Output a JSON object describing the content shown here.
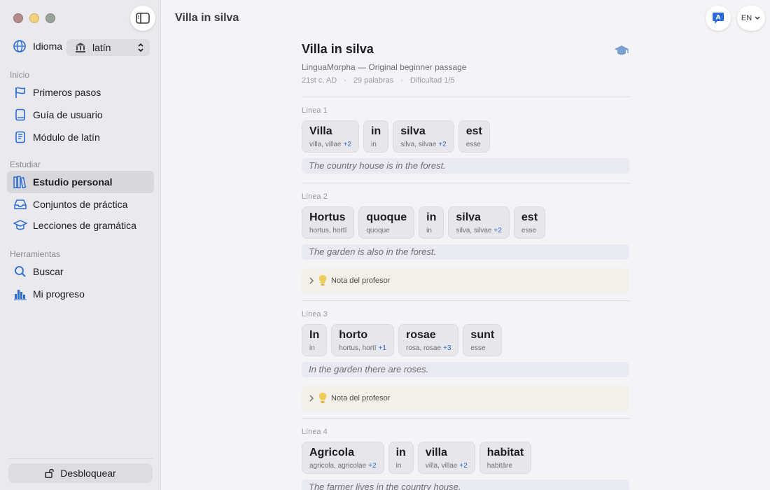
{
  "window": {
    "title": "Villa in silva"
  },
  "sidebar": {
    "language_label": "Idioma",
    "language_value": "latín",
    "sections": [
      {
        "title": "Inicio",
        "items": [
          {
            "label": "Primeros pasos",
            "icon": "flag-icon"
          },
          {
            "label": "Guía de usuario",
            "icon": "book-icon"
          },
          {
            "label": "Módulo de latín",
            "icon": "module-book-icon"
          }
        ]
      },
      {
        "title": "Estudiar",
        "items": [
          {
            "label": "Estudio personal",
            "icon": "books-icon",
            "active": true
          },
          {
            "label": "Conjuntos de práctica",
            "icon": "tray-icon"
          },
          {
            "label": "Lecciones de gramática",
            "icon": "graduation-cap-icon"
          }
        ]
      },
      {
        "title": "Herramientas",
        "items": [
          {
            "label": "Buscar",
            "icon": "search-icon"
          },
          {
            "label": "Mi progreso",
            "icon": "bar-chart-icon"
          }
        ]
      }
    ],
    "unlock_label": "Desbloquear"
  },
  "header": {
    "lang_button": "EN"
  },
  "passage": {
    "title": "Villa in silva",
    "subtitle": "LinguaMorpha — Original beginner passage",
    "meta": [
      "21st c. AD",
      "29 palabras",
      "Dificultad 1/5"
    ],
    "note_label": "Nota del profesor",
    "lines": [
      {
        "label": "Línea 1",
        "words": [
          {
            "w": "Villa",
            "g": "villa, villae",
            "more": "+2"
          },
          {
            "w": "in",
            "g": "in",
            "more": ""
          },
          {
            "w": "silva",
            "g": "silva, silvae",
            "more": "+2"
          },
          {
            "w": "est",
            "g": "esse",
            "more": ""
          }
        ],
        "translation": "The country house is in the forest.",
        "has_note": false
      },
      {
        "label": "Línea 2",
        "words": [
          {
            "w": "Hortus",
            "g": "hortus, hortī",
            "more": ""
          },
          {
            "w": "quoque",
            "g": "quoque",
            "more": ""
          },
          {
            "w": "in",
            "g": "in",
            "more": ""
          },
          {
            "w": "silva",
            "g": "silva, silvae",
            "more": "+2"
          },
          {
            "w": "est",
            "g": "esse",
            "more": ""
          }
        ],
        "translation": "The garden is also in the forest.",
        "has_note": true
      },
      {
        "label": "Línea 3",
        "words": [
          {
            "w": "In",
            "g": "in",
            "more": ""
          },
          {
            "w": "horto",
            "g": "hortus, hortī",
            "more": "+1"
          },
          {
            "w": "rosae",
            "g": "rosa, rosae",
            "more": "+3"
          },
          {
            "w": "sunt",
            "g": "esse",
            "more": ""
          }
        ],
        "translation": "In the garden there are roses.",
        "has_note": true
      },
      {
        "label": "Línea 4",
        "words": [
          {
            "w": "Agricola",
            "g": "agricola, agricolae",
            "more": "+2"
          },
          {
            "w": "in",
            "g": "in",
            "more": ""
          },
          {
            "w": "villa",
            "g": "villa, villae",
            "more": "+2"
          },
          {
            "w": "habitat",
            "g": "habitāre",
            "more": ""
          }
        ],
        "translation": "The farmer lives in the country house.",
        "has_note": false
      }
    ]
  },
  "colors": {
    "accent": "#2a6cd4",
    "note_bg": "#f2f0e8",
    "translation_bg": "#e8e9f1",
    "bulb": "#f0cc5a"
  }
}
